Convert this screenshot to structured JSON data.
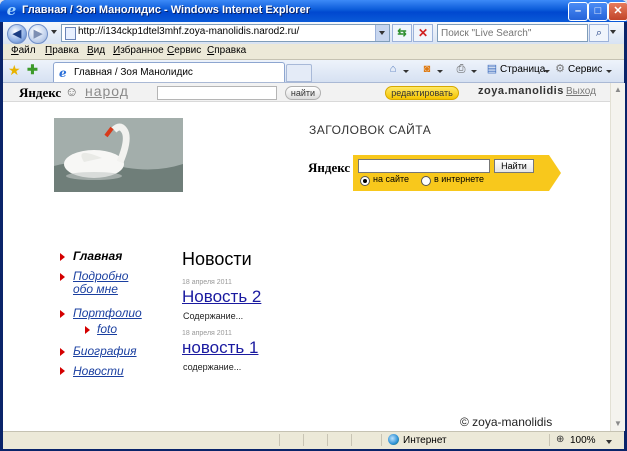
{
  "window": {
    "title": "Главная / Зоя Манолидис - Windows Internet Explorer"
  },
  "addressbar": {
    "url": "http://i134ckp1dtel3mhf.zoya-manolidis.narod2.ru/",
    "search_placeholder": "Поиск \"Live Search\""
  },
  "menu": {
    "items": [
      "Файл",
      "Правка",
      "Вид",
      "Избранное",
      "Сервис",
      "Справка"
    ]
  },
  "tabs": {
    "active_label": "Главная / Зоя Манолидис"
  },
  "commandbar": {
    "page_label": "Страница",
    "tools_label": "Сервис"
  },
  "narod_bar": {
    "logo_yandex": "Яндекс",
    "logo_narod": "народ",
    "find_label": "найти",
    "edit_label": "редактировать",
    "username": "zoya.manolidis",
    "logout_label": "Выход"
  },
  "header": {
    "site_title": "ЗАГОЛОВОК САЙТА"
  },
  "yandex_search": {
    "logo": "Яндекс",
    "button_label": "Найти",
    "option_site": "на сайте",
    "option_internet": "в интернете"
  },
  "nav": {
    "items": [
      {
        "label": "Главная"
      },
      {
        "label_line1": "Подробно",
        "label_line2": "обо мне"
      },
      {
        "label": "Портфолио"
      },
      {
        "label": "foto"
      },
      {
        "label": "Биография"
      },
      {
        "label": "Новости"
      }
    ]
  },
  "news": {
    "heading": "Новости",
    "items": [
      {
        "date": "18 апреля 2011",
        "title": "Новость 2",
        "body": "Содержание..."
      },
      {
        "date": "18 апреля 2011",
        "title": "новость 1",
        "body": "содержание..."
      }
    ]
  },
  "footer": {
    "copyright": "© zoya-manolidis"
  },
  "statusbar": {
    "zone": "Интернет",
    "zoom": "100%"
  }
}
